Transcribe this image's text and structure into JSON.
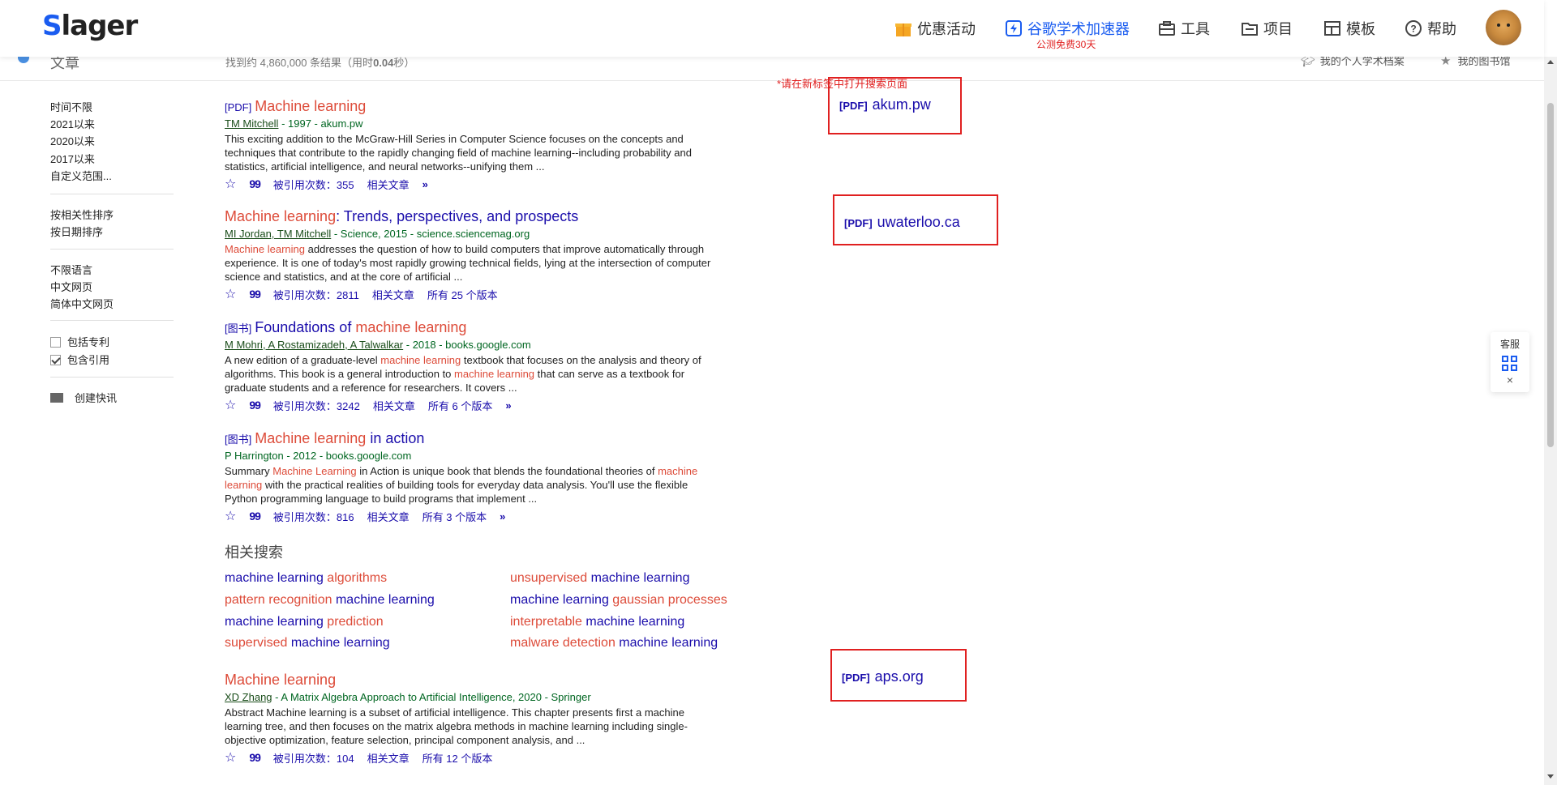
{
  "header": {
    "logo_first": "S",
    "logo_rest": "lager",
    "nav": [
      {
        "label": "优惠活动"
      },
      {
        "label": "谷歌学术加速器",
        "sub": "公测免费30天"
      },
      {
        "label": "工具"
      },
      {
        "label": "项目"
      },
      {
        "label": "模板"
      },
      {
        "label": "帮助"
      }
    ]
  },
  "subheader": {
    "section": "文章",
    "count_prefix": "找到约 4,860,000 条结果（用时",
    "count_time": "0.04",
    "count_suffix": "秒）",
    "profile_link": "我的个人学术档案",
    "library_link": "我的图书馆"
  },
  "sidebar": {
    "time": [
      "时间不限",
      "2021以来",
      "2020以来",
      "2017以来",
      "自定义范围..."
    ],
    "sort": [
      "按相关性排序",
      "按日期排序"
    ],
    "lang": [
      "不限语言",
      "中文网页",
      "简体中文网页"
    ],
    "include_patents": "包括专利",
    "include_citations": "包含引用",
    "create_alert": "创建快讯"
  },
  "notice": "*请在新标签中打开搜索页面",
  "results": [
    {
      "tag": "[PDF]",
      "title_hl": "Machine learning",
      "title_rest": "",
      "authors": "TM Mitchell",
      "meta_rest": " - 1997 - akum.pw",
      "snippet_parts": [
        "This exciting addition to the McGraw-Hill Series in Computer Science focuses on the concepts and techniques that contribute to the rapidly changing field of machine learning--including probability and statistics, artificial intelligence, and neural networks--unifying them ..."
      ],
      "cited": "被引用次数：355",
      "related": "相关文章",
      "versions": "",
      "pdf_side": "akum.pw"
    },
    {
      "tag": "",
      "title_hl": "Machine learning",
      "title_rest": ": Trends, perspectives, and prospects",
      "authors": "MI Jordan, TM Mitchell",
      "meta_rest": " - Science, 2015 - science.sciencemag.org",
      "snippet_hl": "Machine learning",
      "snippet_rest": " addresses the question of how to build computers that improve automatically through experience. It is one of today's most rapidly growing technical fields, lying at the intersection of computer science and statistics, and at the core of artificial ...",
      "cited": "被引用次数：2811",
      "related": "相关文章",
      "versions": "所有 25 个版本",
      "pdf_side": "uwaterloo.ca"
    },
    {
      "tag": "[图书]",
      "title_pre": "Foundations of ",
      "title_hl": "machine learning",
      "authors": "M Mohri, A Rostamizadeh, A Talwalkar",
      "meta_rest": " - 2018 - books.google.com",
      "snippet_a": "A new edition of a graduate-level ",
      "snippet_hl1": "machine learning",
      "snippet_b": " textbook that focuses on the analysis and theory of algorithms. This book is a general introduction to ",
      "snippet_hl2": "machine learning",
      "snippet_c": " that can serve as a textbook for graduate students and a reference for researchers. It covers ...",
      "cited": "被引用次数：3242",
      "related": "相关文章",
      "versions": "所有 6 个版本"
    },
    {
      "tag": "[图书]",
      "title_hl": "Machine learning",
      "title_rest": " in action",
      "authors": "P Harrington",
      "meta_rest": " - 2012 - books.google.com",
      "snippet_a": "Summary ",
      "snippet_hl1": "Machine Learning",
      "snippet_b": " in Action is unique book that blends the foundational theories of ",
      "snippet_hl2": "machine learning",
      "snippet_c": " with the practical realities of building tools for everyday data analysis. You'll use the flexible Python programming language to build programs that implement ...",
      "cited": "被引用次数：816",
      "related": "相关文章",
      "versions": "所有 3 个版本"
    },
    {
      "tag": "",
      "title_hl": "Machine learning",
      "authors": "XD Zhang",
      "meta_rest": " - A Matrix Algebra Approach to Artificial Intelligence, 2020 - Springer",
      "snippet": "Abstract Machine learning is a subset of artificial intelligence. This chapter presents first a machine learning tree, and then focuses on the matrix algebra methods in machine learning including single-objective optimization, feature selection, principal component analysis, and ...",
      "cited": "被引用次数：104",
      "related": "相关文章",
      "versions": "所有 12 个版本",
      "pdf_side": "aps.org"
    }
  ],
  "pdf_label": "[PDF]",
  "related_title": "相关搜索",
  "related": [
    {
      "a": "machine learning",
      "b": " algorithms"
    },
    {
      "a": "unsupervised",
      "b": " machine learning"
    },
    {
      "a": "pattern recognition",
      "b": " machine learning"
    },
    {
      "a": "machine learning",
      "b": " gaussian processes"
    },
    {
      "a": "machine learning",
      "b": " prediction"
    },
    {
      "a": "interpretable",
      "b": " machine learning"
    },
    {
      "a": "supervised",
      "b": " machine learning"
    },
    {
      "a": "malware detection",
      "b": " machine learning"
    }
  ],
  "service": {
    "label": "客服",
    "close": "×"
  }
}
